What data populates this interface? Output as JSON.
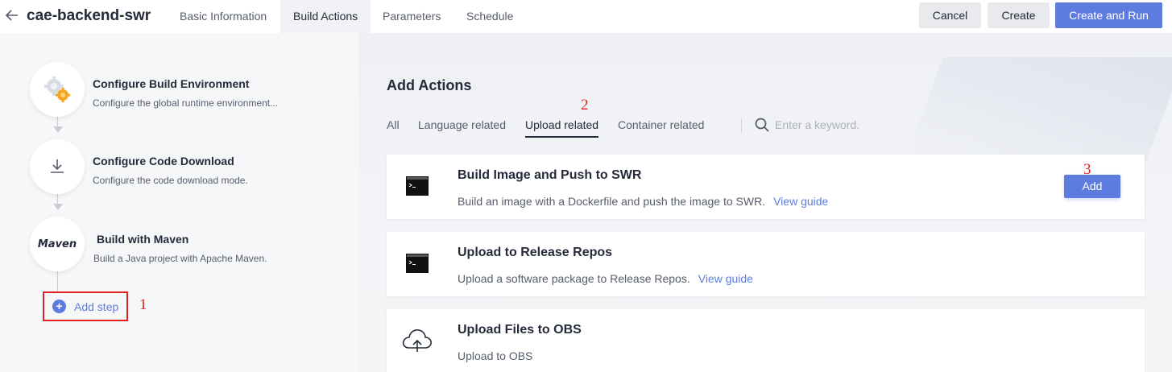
{
  "header": {
    "title": "cae-backend-swr",
    "tabs": [
      {
        "label": "Basic Information"
      },
      {
        "label": "Build Actions"
      },
      {
        "label": "Parameters"
      },
      {
        "label": "Schedule"
      }
    ],
    "cancel_label": "Cancel",
    "create_label": "Create",
    "create_run_label": "Create and Run"
  },
  "steps": [
    {
      "title": "Configure Build Environment",
      "desc": "Configure the global runtime environment...",
      "icon": "gears-icon"
    },
    {
      "title": "Configure Code Download",
      "desc": "Configure the code download mode.",
      "icon": "download-icon"
    },
    {
      "title": "Build with Maven",
      "desc": "Build a Java project with Apache Maven.",
      "icon": "maven-logo",
      "logo_text": "Maven"
    }
  ],
  "add_step_label": "Add step",
  "markers": [
    "1",
    "2",
    "3"
  ],
  "actions_panel": {
    "title": "Add Actions",
    "filters": [
      {
        "label": "All"
      },
      {
        "label": "Language related"
      },
      {
        "label": "Upload related"
      },
      {
        "label": "Container related"
      }
    ],
    "active_filter": "Upload related",
    "search_placeholder": "Enter a keyword.",
    "cards": [
      {
        "title": "Build Image and Push to SWR",
        "desc": "Build an image with a Dockerfile and push the image to SWR.",
        "guide": "View guide",
        "add_label": "Add",
        "icon": "terminal-icon"
      },
      {
        "title": "Upload to Release Repos",
        "desc": "Upload a software package to Release Repos.",
        "guide": "View guide",
        "icon": "terminal-icon"
      },
      {
        "title": "Upload Files to OBS",
        "desc": "Upload to OBS",
        "icon": "cloud-upload-icon"
      }
    ]
  },
  "colors": {
    "primary": "#5e7ce0",
    "highlight": "#e02020",
    "text": "#252b3a"
  }
}
